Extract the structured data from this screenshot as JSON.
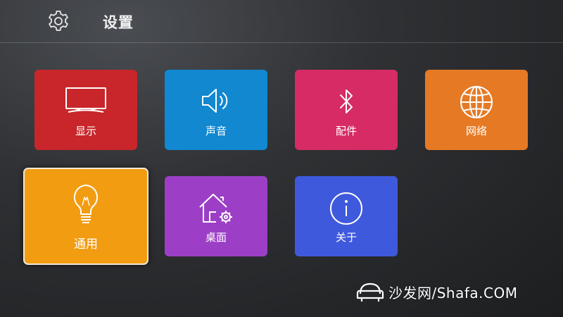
{
  "header": {
    "title": "设置",
    "icon": "gear-icon"
  },
  "tiles": [
    {
      "id": "display",
      "label": "显示",
      "icon": "tv-icon",
      "color": "#c8262a"
    },
    {
      "id": "sound",
      "label": "声音",
      "icon": "speaker-icon",
      "color": "#1188d0"
    },
    {
      "id": "accessories",
      "label": "配件",
      "icon": "bluetooth-icon",
      "color": "#d62b64"
    },
    {
      "id": "network",
      "label": "网络",
      "icon": "globe-icon",
      "color": "#e67a24"
    },
    {
      "id": "general",
      "label": "通用",
      "icon": "lightbulb-icon",
      "color": "#f29c12",
      "selected": true
    },
    {
      "id": "desktop",
      "label": "桌面",
      "icon": "home-settings-icon",
      "color": "#9c3fc6"
    },
    {
      "id": "about",
      "label": "关于",
      "icon": "info-icon",
      "color": "#3f59dd"
    }
  ],
  "watermark": {
    "text": "沙发网/Shafa.COM",
    "icon": "sofa-logo-icon"
  }
}
